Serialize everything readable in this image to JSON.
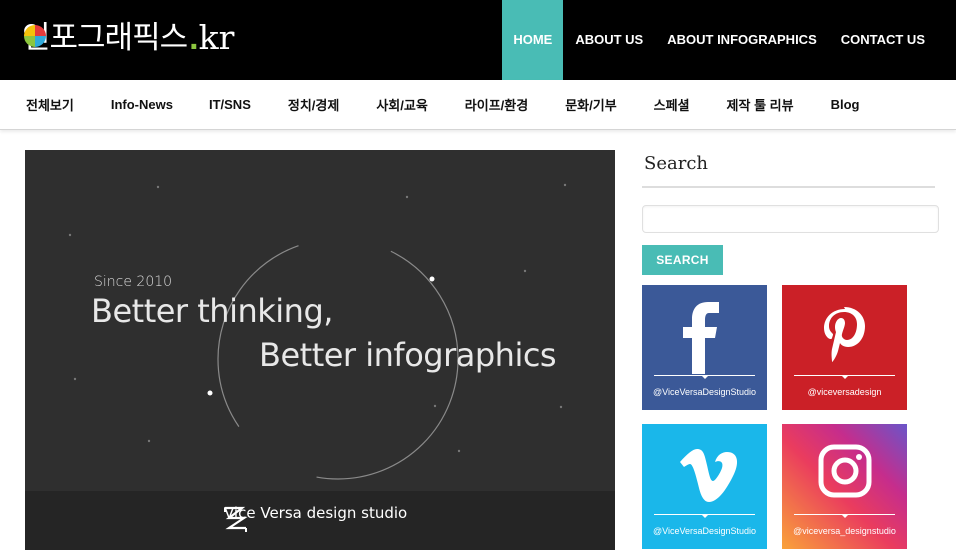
{
  "header": {
    "logo_korean": "인포그래픽스",
    "logo_dot": ".",
    "logo_suffix": "kr",
    "nav": [
      {
        "label": "HOME",
        "active": true
      },
      {
        "label": "ABOUT US",
        "active": false
      },
      {
        "label": "ABOUT INFOGRAPHICS",
        "active": false
      },
      {
        "label": "CONTACT US",
        "active": false
      }
    ]
  },
  "categories": [
    "전체보기",
    "Info-News",
    "IT/SNS",
    "정치/경제",
    "사회/교육",
    "라이프/환경",
    "문화/기부",
    "스페셜",
    "제작 툴 리뷰",
    "Blog"
  ],
  "hero": {
    "since": "Since 2010",
    "line1": "Better thinking,",
    "line2": "Better infographics",
    "brand": "Vice Versa design studio"
  },
  "sidebar": {
    "search_title": "Search",
    "search_placeholder": "",
    "search_button": "SEARCH",
    "social": [
      {
        "network": "facebook",
        "icon": "facebook-icon",
        "handle": "@ViceVersaDesignStudio",
        "color": "#3b5998"
      },
      {
        "network": "pinterest",
        "icon": "pinterest-icon",
        "handle": "@viceversadesign",
        "color": "#cb2027"
      },
      {
        "network": "vimeo",
        "icon": "vimeo-icon",
        "handle": "@ViceVersaDesignStudio",
        "color": "#1ab7ea"
      },
      {
        "network": "instagram",
        "icon": "instagram-icon",
        "handle": "@viceversa_designstudio",
        "color": "#e1306c"
      }
    ]
  },
  "colors": {
    "accent": "#49bcb5",
    "header_bg": "#000000",
    "hero_bg": "#2f2f2f"
  }
}
